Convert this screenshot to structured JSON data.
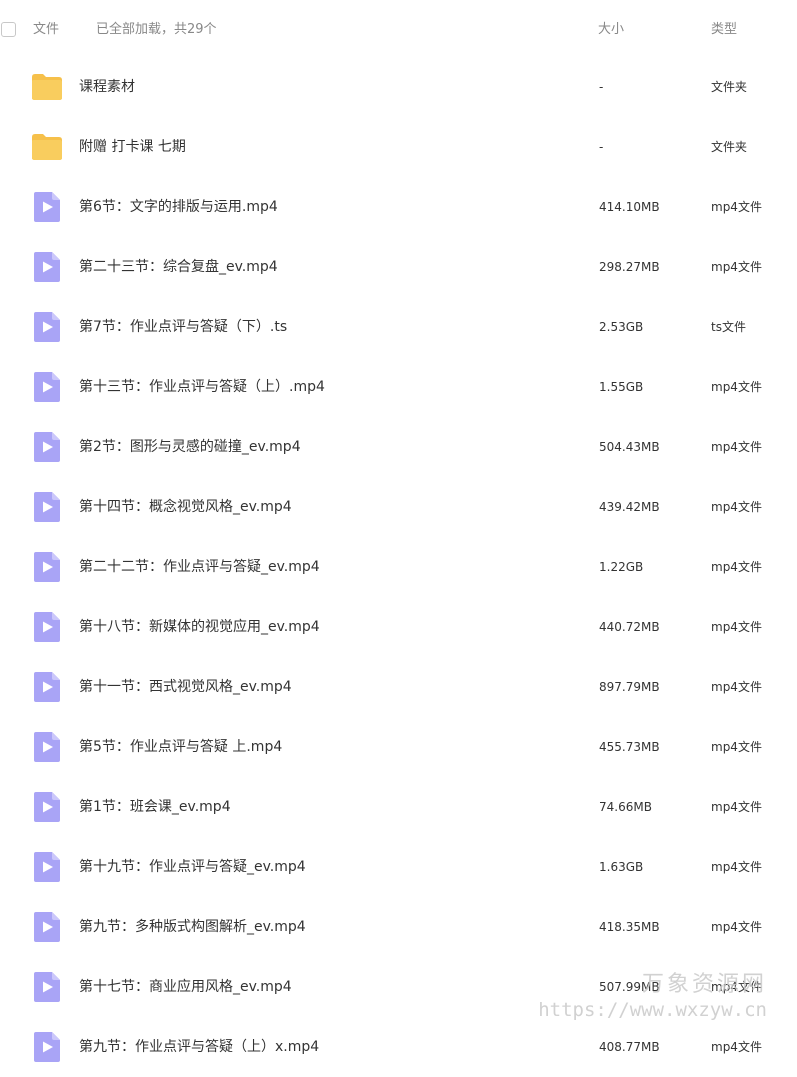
{
  "header": {
    "name_label": "文件",
    "status": "已全部加载，共29个",
    "size_label": "大小",
    "type_label": "类型"
  },
  "files": [
    {
      "name": "课程素材",
      "size": "-",
      "type": "文件夹",
      "icon": "folder-icon"
    },
    {
      "name": "附赠 打卡课 七期",
      "size": "-",
      "type": "文件夹",
      "icon": "folder-icon"
    },
    {
      "name": "第6节：文字的排版与运用.mp4",
      "size": "414.10MB",
      "type": "mp4文件",
      "icon": "video-file-icon"
    },
    {
      "name": "第二十三节：综合复盘_ev.mp4",
      "size": "298.27MB",
      "type": "mp4文件",
      "icon": "video-file-icon"
    },
    {
      "name": "第7节：作业点评与答疑（下）.ts",
      "size": "2.53GB",
      "type": "ts文件",
      "icon": "video-file-icon"
    },
    {
      "name": "第十三节：作业点评与答疑（上）.mp4",
      "size": "1.55GB",
      "type": "mp4文件",
      "icon": "video-file-icon"
    },
    {
      "name": "第2节：图形与灵感的碰撞_ev.mp4",
      "size": "504.43MB",
      "type": "mp4文件",
      "icon": "video-file-icon"
    },
    {
      "name": "第十四节：概念视觉风格_ev.mp4",
      "size": "439.42MB",
      "type": "mp4文件",
      "icon": "video-file-icon"
    },
    {
      "name": "第二十二节：作业点评与答疑_ev.mp4",
      "size": "1.22GB",
      "type": "mp4文件",
      "icon": "video-file-icon"
    },
    {
      "name": "第十八节：新媒体的视觉应用_ev.mp4",
      "size": "440.72MB",
      "type": "mp4文件",
      "icon": "video-file-icon"
    },
    {
      "name": "第十一节：西式视觉风格_ev.mp4",
      "size": "897.79MB",
      "type": "mp4文件",
      "icon": "video-file-icon"
    },
    {
      "name": "第5节：作业点评与答疑 上.mp4",
      "size": "455.73MB",
      "type": "mp4文件",
      "icon": "video-file-icon"
    },
    {
      "name": "第1节：班会课_ev.mp4",
      "size": "74.66MB",
      "type": "mp4文件",
      "icon": "video-file-icon"
    },
    {
      "name": "第十九节：作业点评与答疑_ev.mp4",
      "size": "1.63GB",
      "type": "mp4文件",
      "icon": "video-file-icon"
    },
    {
      "name": "第九节：多种版式构图解析_ev.mp4",
      "size": "418.35MB",
      "type": "mp4文件",
      "icon": "video-file-icon"
    },
    {
      "name": "第十七节：商业应用风格_ev.mp4",
      "size": "507.99MB",
      "type": "mp4文件",
      "icon": "video-file-icon"
    },
    {
      "name": "第九节：作业点评与答疑（上）x.mp4",
      "size": "408.77MB",
      "type": "mp4文件",
      "icon": "video-file-icon"
    }
  ],
  "watermark": {
    "text": "万象资源网",
    "url": "https://www.wxzyw.cn"
  },
  "colors": {
    "folder": "#f9cd5e",
    "video": "#a9a4f6",
    "header_text": "#888888",
    "body_text": "#333333"
  }
}
